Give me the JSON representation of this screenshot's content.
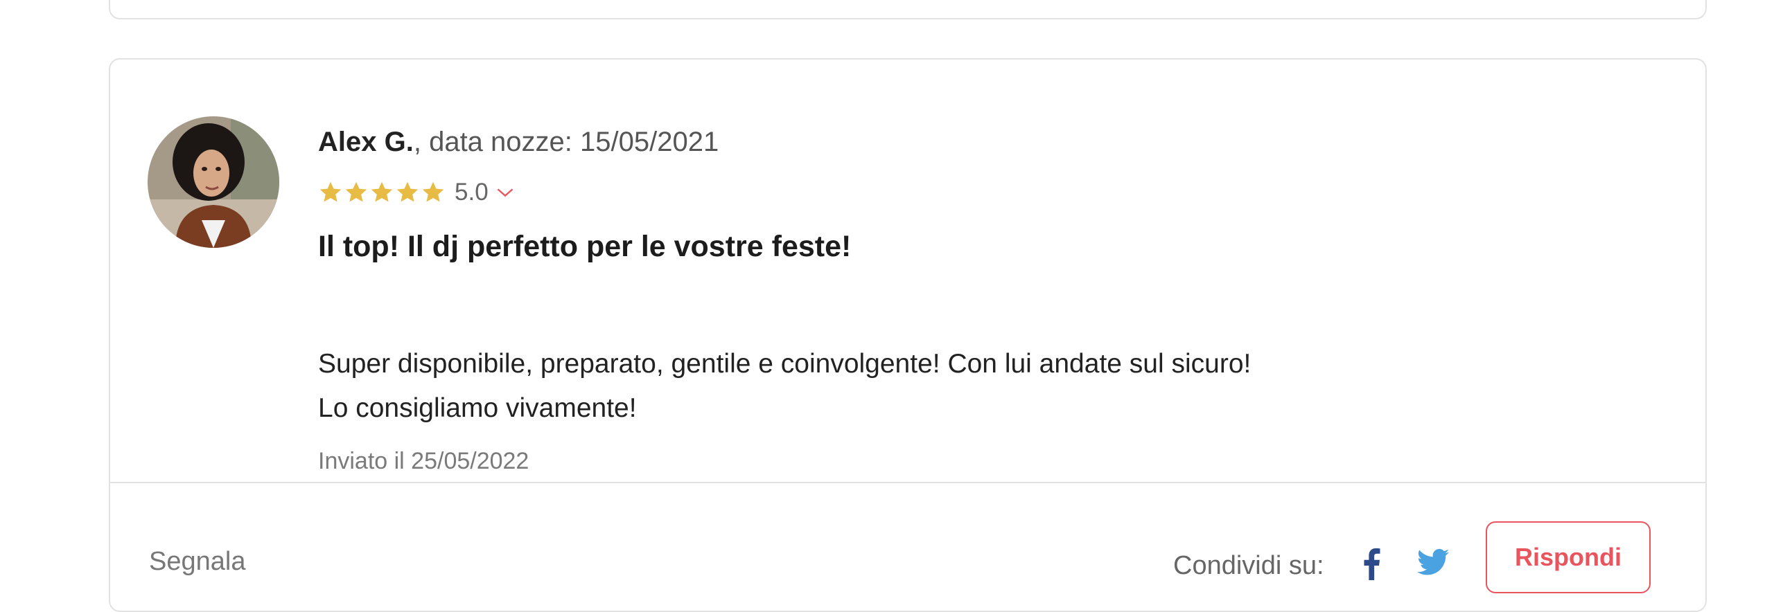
{
  "review": {
    "author": "Alex G.",
    "wedding_date_text": ", data nozze: 15/05/2021",
    "rating": {
      "value_label": "5.0",
      "stars": 5,
      "max": 5
    },
    "title": "Il top! Il dj perfetto per le vostre feste!",
    "body_lines": [
      "Super disponibile, preparato, gentile e coinvolgente! Con lui andate sul sicuro!",
      "Lo consigliamo vivamente!"
    ],
    "sent_date": "Inviato il 25/05/2022"
  },
  "footer": {
    "report_label": "Segnala",
    "share_label": "Condividi su:",
    "share_icons": [
      "facebook-icon",
      "twitter-icon"
    ],
    "reply_label": "Rispondi"
  },
  "colors": {
    "star": "#e8bb45",
    "accent": "#e8555e",
    "facebook": "#2d4a8a",
    "twitter": "#4aa3e0",
    "border": "#e2e2e2"
  }
}
